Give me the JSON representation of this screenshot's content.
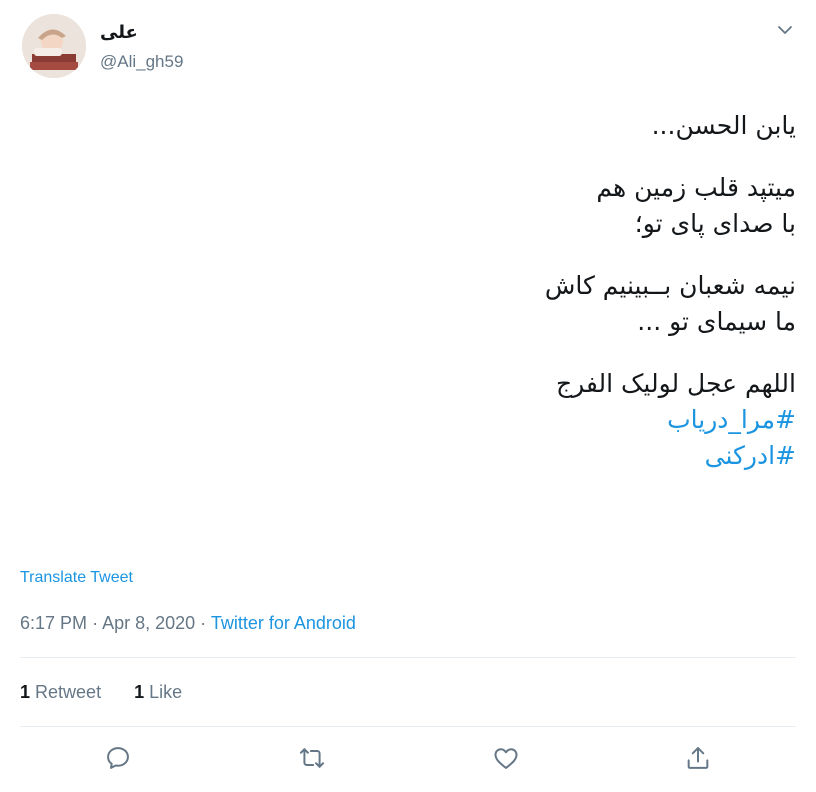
{
  "author": {
    "display_name": "علی",
    "handle": "@Ali_gh59"
  },
  "tweet": {
    "lines": [
      "یابن الحسن...",
      "",
      "میتپد قلب زمین هم",
      "با صدای پای تو؛     ",
      "",
      "نیمه شعبان بــبینیم کاش",
      "ما سیمای تو ...        ",
      "",
      "اللهم عجل لولیک الفرج"
    ],
    "hashtags": [
      "#مرا_دریاب",
      "#ادرکنی"
    ]
  },
  "translate_label": "Translate Tweet",
  "meta": {
    "time": "6:17 PM",
    "separator": "·",
    "date": "Apr 8, 2020",
    "source": "Twitter for Android"
  },
  "stats": {
    "retweets_count": "1",
    "retweets_label": "Retweet",
    "likes_count": "1",
    "likes_label": "Like"
  },
  "icons": {
    "caret": "chevron-down-icon",
    "reply": "reply-icon",
    "retweet": "retweet-icon",
    "like": "heart-icon",
    "share": "share-icon"
  },
  "colors": {
    "link": "#1b95e0",
    "secondary_text": "#657786",
    "primary_text": "#14171a",
    "divider": "#e6ecf0"
  }
}
